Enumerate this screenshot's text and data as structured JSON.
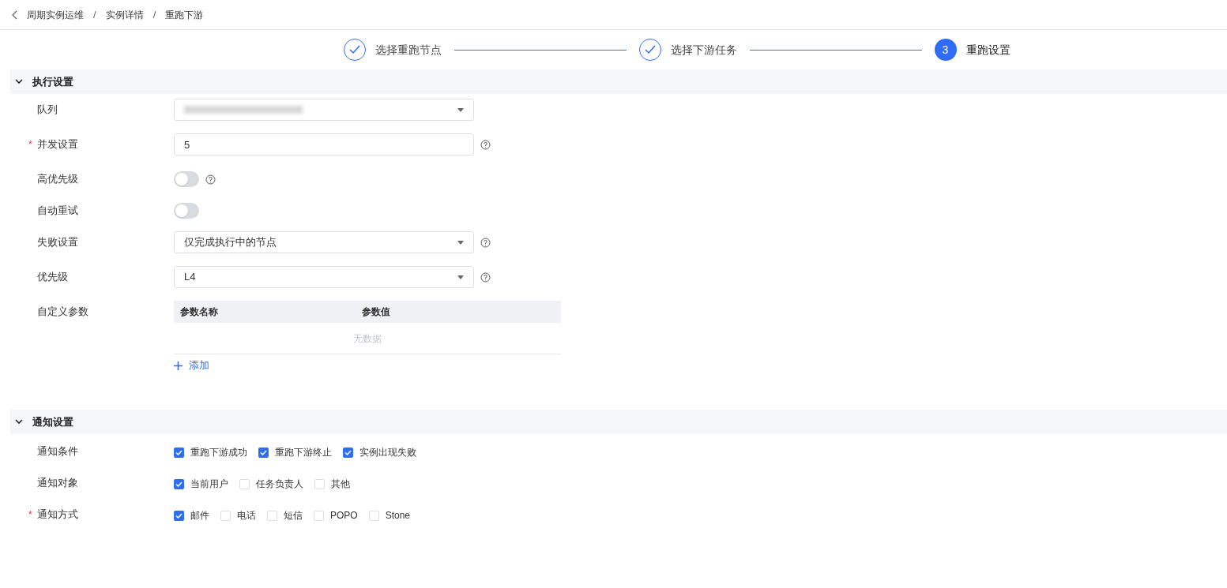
{
  "breadcrumb": {
    "items": [
      "周期实例运维",
      "实例详情",
      "重跑下游"
    ],
    "separators": [
      "/",
      "/"
    ]
  },
  "steps": [
    {
      "label": "选择重跑节点",
      "done": true
    },
    {
      "label": "选择下游任务",
      "done": true
    },
    {
      "label": "重跑设置",
      "done": false,
      "number": "3"
    }
  ],
  "sections": [
    {
      "title": "执行设置",
      "expanded": true,
      "rows": [
        {
          "kind": "select",
          "label": "队列",
          "blurred": true,
          "help": false
        },
        {
          "kind": "input",
          "label": "并发设置",
          "required_mark": "*",
          "value": "5",
          "help": true
        },
        {
          "kind": "switch",
          "label": "高优先级",
          "on": false,
          "help": true
        },
        {
          "kind": "switch",
          "label": "自动重试",
          "on": false,
          "help": false
        },
        {
          "kind": "select",
          "label": "失败设置",
          "value": "仅完成执行中的节点",
          "help": true
        },
        {
          "kind": "select",
          "label": "优先级",
          "value": "L4",
          "help": true
        },
        {
          "kind": "table",
          "label": "自定义参数",
          "columns": [
            "参数名称",
            "参数值"
          ],
          "empty_text": "无数据",
          "add_label": "添加"
        }
      ]
    },
    {
      "title": "通知设置",
      "expanded": true,
      "rows": [
        {
          "kind": "checks",
          "label": "通知条件",
          "options": [
            {
              "label": "重跑下游成功",
              "checked": true
            },
            {
              "label": "重跑下游终止",
              "checked": true
            },
            {
              "label": "实例出现失败",
              "checked": true
            }
          ]
        },
        {
          "kind": "checks",
          "label": "通知对象",
          "options": [
            {
              "label": "当前用户",
              "checked": true
            },
            {
              "label": "任务负责人",
              "checked": false
            },
            {
              "label": "其他",
              "checked": false
            }
          ]
        },
        {
          "kind": "checks",
          "label": "通知方式",
          "required_mark": "*",
          "options": [
            {
              "label": "邮件",
              "checked": true
            },
            {
              "label": "电话",
              "checked": false
            },
            {
              "label": "短信",
              "checked": false
            },
            {
              "label": "POPO",
              "checked": false
            },
            {
              "label": "Stone",
              "checked": false
            }
          ]
        }
      ]
    }
  ]
}
